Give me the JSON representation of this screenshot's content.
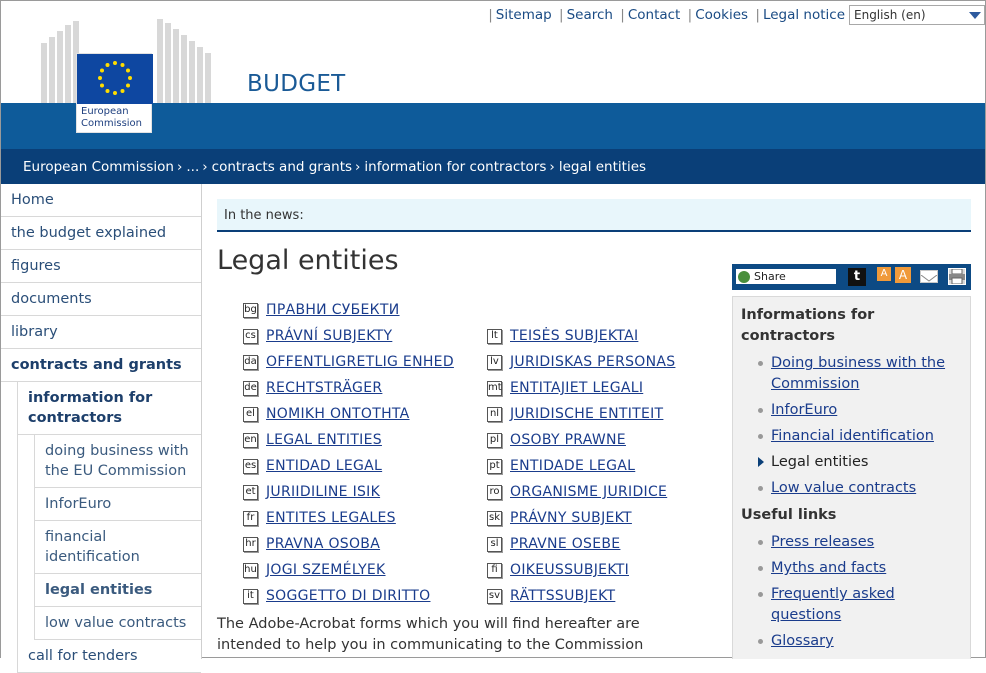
{
  "header": {
    "logo_line1": "European",
    "logo_line2": "Commission",
    "site_title": "BUDGET",
    "top_links": [
      "Sitemap",
      "Search",
      "Contact",
      "Cookies",
      "Legal notice"
    ],
    "language_selected": "English (en)"
  },
  "breadcrumb": [
    "European Commission",
    "...",
    "contracts and grants",
    "information for contractors",
    "legal entities"
  ],
  "left_nav": {
    "items": [
      "Home",
      "the budget explained",
      "figures",
      "documents",
      "library"
    ],
    "active": "contracts and grants",
    "sub_active": "information for contractors",
    "subsub": [
      "doing business with the EU Commission",
      "InforEuro",
      "financial identification",
      "legal entities",
      "low value contracts"
    ],
    "subsub_active_index": 3,
    "after": "call for tenders"
  },
  "news": {
    "label": "In the news:"
  },
  "page_title": "Legal entities",
  "languages_left": [
    {
      "code": "bg",
      "label": "ПРАВНИ СУБЕКТИ"
    },
    {
      "code": "cs",
      "label": "PRÁVNÍ SUBJEKTY"
    },
    {
      "code": "da",
      "label": "OFFENTLIGRETLIG ENHED"
    },
    {
      "code": "de",
      "label": "RECHTSTRÄGER"
    },
    {
      "code": "el",
      "label": "NOMIKH ONTOTHTA"
    },
    {
      "code": "en",
      "label": "LEGAL ENTITIES"
    },
    {
      "code": "es",
      "label": "ENTIDAD LEGAL"
    },
    {
      "code": "et",
      "label": "JURIIDILINE ISIK"
    },
    {
      "code": "fr",
      "label": "ENTITES LEGALES"
    },
    {
      "code": "hr",
      "label": "PRAVNA OSOBA"
    },
    {
      "code": "hu",
      "label": "JOGI SZEMÉLYEK"
    },
    {
      "code": "it",
      "label": "SOGGETTO DI DIRITTO"
    }
  ],
  "languages_right": [
    {
      "code": "lt",
      "label": "TEISĖS SUBJEKTAI"
    },
    {
      "code": "lv",
      "label": "JURIDISKAS PERSONAS"
    },
    {
      "code": "mt",
      "label": "ENTITAJIET LEGALI"
    },
    {
      "code": "nl",
      "label": "JURIDISCHE ENTITEIT"
    },
    {
      "code": "pl",
      "label": "OSOBY PRAWNE"
    },
    {
      "code": "pt",
      "label": "ENTIDADE LEGAL"
    },
    {
      "code": "ro",
      "label": "ORGANISME JURIDICE"
    },
    {
      "code": "sk",
      "label": "PRÁVNY SUBJEKT"
    },
    {
      "code": "sl",
      "label": "PRAVNE OSEBE"
    },
    {
      "code": "fi",
      "label": "OIKEUSSUBJEKTI"
    },
    {
      "code": "sv",
      "label": "RÄTTSSUBJEKT"
    }
  ],
  "intro_text": "The Adobe-Acrobat forms which you will find hereafter are intended to help you in communicating to the Commission",
  "share": {
    "label": "Share",
    "t_label": "t",
    "font_small": "A",
    "font_large": "A"
  },
  "sidebar": {
    "section1_title": "Informations for contractors",
    "section1_items": [
      {
        "label": "Doing business with the Commission",
        "link": true
      },
      {
        "label": "InforEuro",
        "link": true
      },
      {
        "label": "Financial identification",
        "link": true
      },
      {
        "label": "Legal entities",
        "link": false
      },
      {
        "label": "Low value contracts",
        "link": true
      }
    ],
    "section2_title": "Useful links",
    "section2_items": [
      {
        "label": "Press releases"
      },
      {
        "label": "Myths and facts"
      },
      {
        "label": "Frequently asked questions"
      },
      {
        "label": "Glossary"
      }
    ]
  },
  "colors": {
    "band_blue": "#0e5b9a",
    "breadcrumb_blue": "#0a3f78",
    "link_blue": "#1a3c8c",
    "news_bg": "#e8f6fb"
  }
}
